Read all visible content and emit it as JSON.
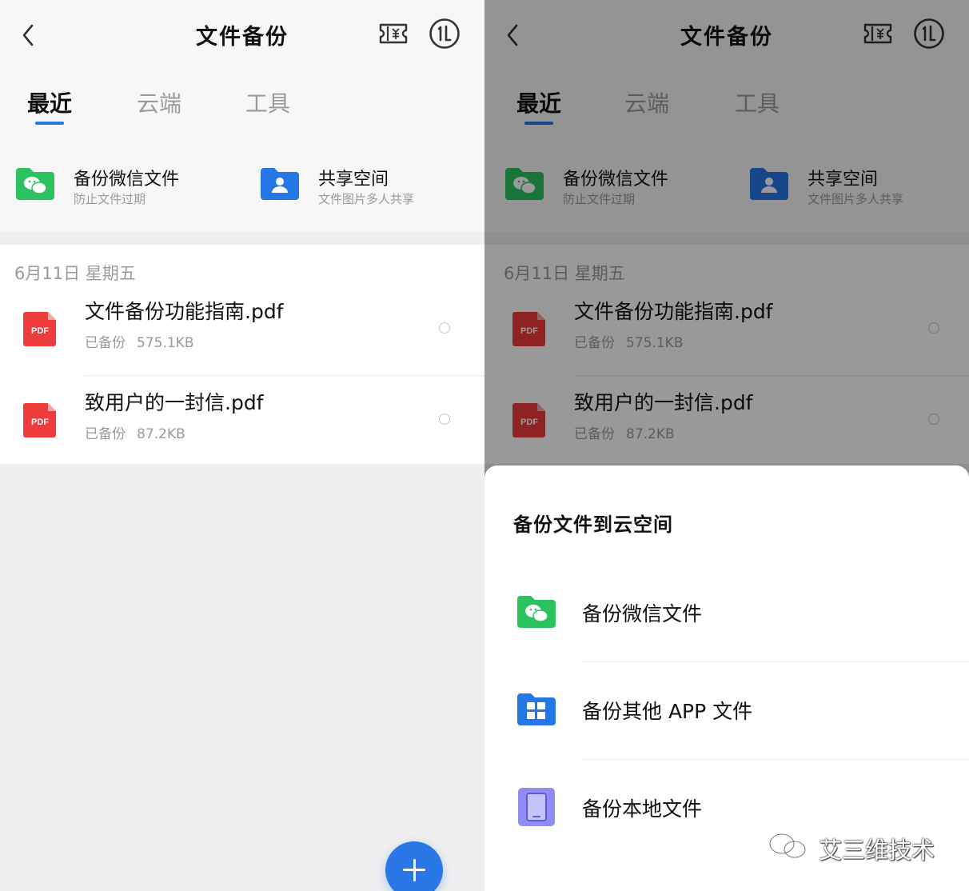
{
  "colors": {
    "accent": "#2a77e8",
    "wechat_green": "#2bc25f",
    "pdf_red": "#ee3b3b",
    "folder_blue": "#2577e6",
    "local_purple": "#8f8df5"
  },
  "left": {
    "header": {
      "title": "文件备份",
      "back_icon": "chevron-left-icon",
      "ticket_icon": "ticket-icon",
      "speed_icon": "speed-circle-icon"
    },
    "tabs": [
      {
        "label": "最近",
        "active": true
      },
      {
        "label": "云端",
        "active": false
      },
      {
        "label": "工具",
        "active": false
      }
    ],
    "quick_actions": [
      {
        "title": "备份微信文件",
        "subtitle": "防止文件过期",
        "icon": "wechat-folder-icon"
      },
      {
        "title": "共享空间",
        "subtitle": "文件图片多人共享",
        "icon": "shared-folder-icon"
      }
    ],
    "list": {
      "date_header": "6月11日 星期五",
      "files": [
        {
          "name": "文件备份功能指南.pdf",
          "status": "已备份",
          "size": "575.1KB",
          "icon": "pdf-icon"
        },
        {
          "name": "致用户的一封信.pdf",
          "status": "已备份",
          "size": "87.2KB",
          "icon": "pdf-icon"
        }
      ]
    },
    "fab": {
      "icon": "plus-icon"
    }
  },
  "right": {
    "header": {
      "title": "文件备份"
    },
    "tabs": [
      {
        "label": "最近",
        "active": true
      },
      {
        "label": "云端",
        "active": false
      },
      {
        "label": "工具",
        "active": false
      }
    ],
    "quick_actions": [
      {
        "title": "备份微信文件",
        "subtitle": "防止文件过期"
      },
      {
        "title": "共享空间",
        "subtitle": "文件图片多人共享"
      }
    ],
    "list": {
      "date_header": "6月11日 星期五",
      "files": [
        {
          "name": "文件备份功能指南.pdf",
          "status": "已备份",
          "size": "575.1KB"
        },
        {
          "name": "致用户的一封信.pdf",
          "status": "已备份",
          "size": "87.2KB"
        }
      ]
    },
    "sheet": {
      "title": "备份文件到云空间",
      "items": [
        {
          "label": "备份微信文件",
          "icon": "wechat-folder-icon"
        },
        {
          "label": "备份其他 APP 文件",
          "icon": "app-grid-icon"
        },
        {
          "label": "备份本地文件",
          "icon": "phone-icon"
        }
      ]
    }
  },
  "watermark": {
    "text": "艾三维技术",
    "icon": "wechat-logo-icon"
  }
}
